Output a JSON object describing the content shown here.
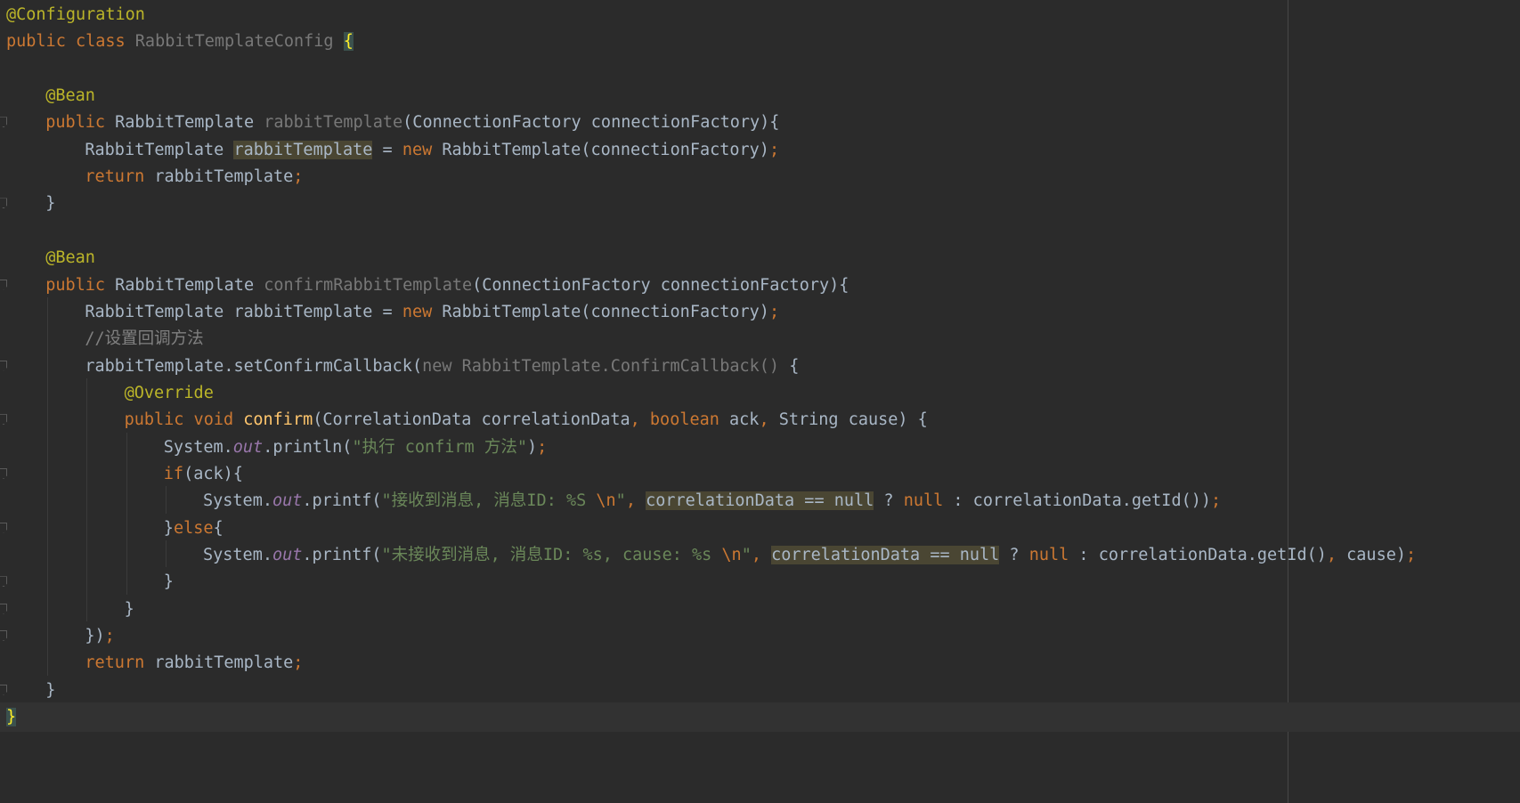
{
  "editor": {
    "theme": "darcula",
    "colors": {
      "background": "#2b2b2b",
      "keyword": "#cc7832",
      "annotation": "#bbb529",
      "string": "#6a8759",
      "comment": "#808080",
      "method": "#ffc66d",
      "static_field": "#9876aa",
      "text": "#a9b7c6"
    },
    "lines": [
      {
        "n": 1,
        "indent": 0,
        "tokens": [
          {
            "t": "@Configuration",
            "c": "ann"
          }
        ]
      },
      {
        "n": 2,
        "indent": 0,
        "tokens": [
          {
            "t": "public class ",
            "c": "kw"
          },
          {
            "t": "RabbitTemplateConfig",
            "c": "unused"
          },
          {
            "t": " ",
            "c": ""
          },
          {
            "t": "{",
            "c": "hl-brace"
          }
        ]
      },
      {
        "n": 3,
        "indent": 0,
        "tokens": []
      },
      {
        "n": 4,
        "indent": 4,
        "tokens": [
          {
            "t": "@Bean",
            "c": "ann"
          }
        ]
      },
      {
        "n": 5,
        "indent": 4,
        "fold": true,
        "tokens": [
          {
            "t": "public ",
            "c": "kw"
          },
          {
            "t": "RabbitTemplate ",
            "c": ""
          },
          {
            "t": "rabbitTemplate",
            "c": "unused"
          },
          {
            "t": "(ConnectionFactory connectionFactory){",
            "c": ""
          }
        ]
      },
      {
        "n": 6,
        "indent": 8,
        "tokens": [
          {
            "t": "RabbitTemplate ",
            "c": ""
          },
          {
            "t": "rabbitTemplate",
            "c": "hl"
          },
          {
            "t": " = ",
            "c": ""
          },
          {
            "t": "new ",
            "c": "kw"
          },
          {
            "t": "RabbitTemplate(connectionFactory)",
            "c": ""
          },
          {
            "t": ";",
            "c": "kw"
          }
        ]
      },
      {
        "n": 7,
        "indent": 8,
        "tokens": [
          {
            "t": "return ",
            "c": "kw"
          },
          {
            "t": "rabbitTemplate",
            "c": ""
          },
          {
            "t": ";",
            "c": "kw"
          }
        ]
      },
      {
        "n": 8,
        "indent": 4,
        "fold": true,
        "tokens": [
          {
            "t": "}",
            "c": ""
          }
        ]
      },
      {
        "n": 9,
        "indent": 0,
        "tokens": []
      },
      {
        "n": 10,
        "indent": 4,
        "tokens": [
          {
            "t": "@Bean",
            "c": "ann"
          }
        ]
      },
      {
        "n": 11,
        "indent": 4,
        "fold": true,
        "tokens": [
          {
            "t": "public ",
            "c": "kw"
          },
          {
            "t": "RabbitTemplate ",
            "c": ""
          },
          {
            "t": "confirmRabbitTemplate",
            "c": "unused"
          },
          {
            "t": "(ConnectionFactory connectionFactory){",
            "c": ""
          }
        ]
      },
      {
        "n": 12,
        "indent": 8,
        "tokens": [
          {
            "t": "RabbitTemplate rabbitTemplate = ",
            "c": ""
          },
          {
            "t": "new ",
            "c": "kw"
          },
          {
            "t": "RabbitTemplate(connectionFactory)",
            "c": ""
          },
          {
            "t": ";",
            "c": "kw"
          }
        ]
      },
      {
        "n": 13,
        "indent": 8,
        "tokens": [
          {
            "t": "//设置回调方法",
            "c": "cmt"
          }
        ]
      },
      {
        "n": 14,
        "indent": 8,
        "fold": true,
        "tokens": [
          {
            "t": "rabbitTemplate.setConfirmCallback(",
            "c": ""
          },
          {
            "t": "new RabbitTemplate.ConfirmCallback()",
            "c": "unused"
          },
          {
            "t": " {",
            "c": ""
          }
        ]
      },
      {
        "n": 15,
        "indent": 12,
        "tokens": [
          {
            "t": "@Override",
            "c": "ann"
          }
        ]
      },
      {
        "n": 16,
        "indent": 12,
        "fold": true,
        "tokens": [
          {
            "t": "public void ",
            "c": "kw"
          },
          {
            "t": "confirm",
            "c": "fn"
          },
          {
            "t": "(CorrelationData correlationData",
            "c": ""
          },
          {
            "t": ", ",
            "c": "kw"
          },
          {
            "t": "boolean ",
            "c": "kw"
          },
          {
            "t": "ack",
            "c": ""
          },
          {
            "t": ", ",
            "c": "kw"
          },
          {
            "t": "String cause) {",
            "c": ""
          }
        ]
      },
      {
        "n": 17,
        "indent": 16,
        "tokens": [
          {
            "t": "System.",
            "c": ""
          },
          {
            "t": "out",
            "c": "static"
          },
          {
            "t": ".println(",
            "c": ""
          },
          {
            "t": "\"执行 confirm 方法\"",
            "c": "str"
          },
          {
            "t": ")",
            "c": ""
          },
          {
            "t": ";",
            "c": "kw"
          }
        ]
      },
      {
        "n": 18,
        "indent": 16,
        "fold": true,
        "tokens": [
          {
            "t": "if",
            "c": "kw"
          },
          {
            "t": "(ack){",
            "c": ""
          }
        ]
      },
      {
        "n": 19,
        "indent": 20,
        "tokens": [
          {
            "t": "System.",
            "c": ""
          },
          {
            "t": "out",
            "c": "static"
          },
          {
            "t": ".printf(",
            "c": ""
          },
          {
            "t": "\"接收到消息, 消息ID: %S ",
            "c": "str"
          },
          {
            "t": "\\n",
            "c": "esc"
          },
          {
            "t": "\"",
            "c": "str"
          },
          {
            "t": ", ",
            "c": "kw"
          },
          {
            "t": "correlationData == null",
            "c": "hl"
          },
          {
            "t": " ? ",
            "c": ""
          },
          {
            "t": "null",
            "c": "kw"
          },
          {
            "t": " : correlationData.getId())",
            "c": ""
          },
          {
            "t": ";",
            "c": "kw"
          }
        ]
      },
      {
        "n": 20,
        "indent": 16,
        "fold": true,
        "tokens": [
          {
            "t": "}",
            "c": ""
          },
          {
            "t": "else",
            "c": "kw"
          },
          {
            "t": "{",
            "c": ""
          }
        ]
      },
      {
        "n": 21,
        "indent": 20,
        "tokens": [
          {
            "t": "System.",
            "c": ""
          },
          {
            "t": "out",
            "c": "static"
          },
          {
            "t": ".printf(",
            "c": ""
          },
          {
            "t": "\"未接收到消息, 消息ID: %s, cause: %s ",
            "c": "str"
          },
          {
            "t": "\\n",
            "c": "esc"
          },
          {
            "t": "\"",
            "c": "str"
          },
          {
            "t": ", ",
            "c": "kw"
          },
          {
            "t": "correlationData == null",
            "c": "hl"
          },
          {
            "t": " ? ",
            "c": ""
          },
          {
            "t": "null",
            "c": "kw"
          },
          {
            "t": " : correlationData.getId()",
            "c": ""
          },
          {
            "t": ", ",
            "c": "kw"
          },
          {
            "t": "cause)",
            "c": ""
          },
          {
            "t": ";",
            "c": "kw"
          }
        ]
      },
      {
        "n": 22,
        "indent": 16,
        "fold": true,
        "tokens": [
          {
            "t": "}",
            "c": ""
          }
        ]
      },
      {
        "n": 23,
        "indent": 12,
        "fold": true,
        "tokens": [
          {
            "t": "}",
            "c": ""
          }
        ]
      },
      {
        "n": 24,
        "indent": 8,
        "fold": true,
        "tokens": [
          {
            "t": "})",
            "c": ""
          },
          {
            "t": ";",
            "c": "kw"
          }
        ]
      },
      {
        "n": 25,
        "indent": 8,
        "tokens": [
          {
            "t": "return ",
            "c": "kw"
          },
          {
            "t": "rabbitTemplate",
            "c": ""
          },
          {
            "t": ";",
            "c": "kw"
          }
        ]
      },
      {
        "n": 26,
        "indent": 4,
        "fold": true,
        "tokens": [
          {
            "t": "}",
            "c": ""
          }
        ]
      },
      {
        "n": 27,
        "indent": 0,
        "current": true,
        "tokens": [
          {
            "t": "}",
            "c": "hl-brace"
          }
        ]
      }
    ]
  }
}
